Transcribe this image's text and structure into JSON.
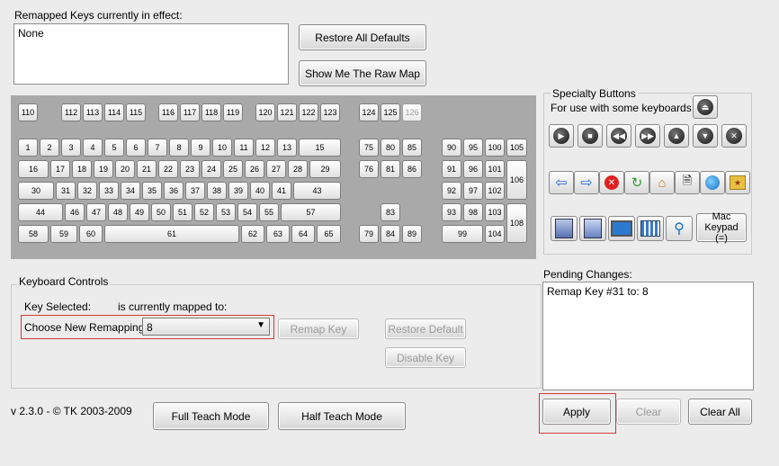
{
  "remapped": {
    "label": "Remapped Keys currently in effect:",
    "value": "None"
  },
  "buttons": {
    "restore_all": "Restore All Defaults",
    "raw_map": "Show Me The Raw Map"
  },
  "keyboard": {
    "fkeys": [
      "110",
      "112",
      "113",
      "114",
      "115",
      "116",
      "117",
      "118",
      "119",
      "120",
      "121",
      "122",
      "123",
      "124",
      "125",
      "126"
    ],
    "row1": [
      "1",
      "2",
      "3",
      "4",
      "5",
      "6",
      "7",
      "8",
      "9",
      "10",
      "11",
      "12",
      "13",
      "15"
    ],
    "row2": [
      "16",
      "17",
      "18",
      "19",
      "20",
      "21",
      "22",
      "23",
      "24",
      "25",
      "26",
      "27",
      "28",
      "29"
    ],
    "row3": [
      "30",
      "31",
      "32",
      "33",
      "34",
      "35",
      "36",
      "37",
      "38",
      "39",
      "40",
      "41",
      "43"
    ],
    "row4": [
      "44",
      "46",
      "47",
      "48",
      "49",
      "50",
      "51",
      "52",
      "53",
      "54",
      "55",
      "57"
    ],
    "row5": [
      "58",
      "59",
      "60",
      "61",
      "62",
      "63",
      "64",
      "65"
    ],
    "nav": [
      "75",
      "80",
      "85",
      "76",
      "81",
      "86",
      "83",
      "79",
      "84",
      "89"
    ],
    "numpad": [
      "90",
      "95",
      "100",
      "105",
      "91",
      "96",
      "101",
      "106",
      "92",
      "97",
      "102",
      "93",
      "98",
      "103",
      "108",
      "99",
      "104"
    ]
  },
  "specialty": {
    "title": "Specialty Buttons",
    "subtitle": "For use with some keyboards",
    "mac_label": "Mac Keypad (=)",
    "icons": [
      "eject-icon",
      "play-icon",
      "stop-icon",
      "rewind-icon",
      "fast-forward-icon",
      "volume-up-icon",
      "volume-down-icon",
      "mute-icon",
      "back-arrow-icon",
      "forward-arrow-icon",
      "stop-page-icon",
      "refresh-icon",
      "home-icon",
      "search-page-icon",
      "web-globe-icon",
      "favorites-icon",
      "my-computer-icon",
      "my-documents-icon",
      "computer-icon",
      "calculator-icon",
      "find-icon"
    ]
  },
  "controls": {
    "title": "Keyboard Controls",
    "key_selected": "Key Selected:",
    "mapped_to": "is currently mapped to:",
    "choose": "Choose New Remapping",
    "selection": "8",
    "remap": "Remap Key",
    "restore_default": "Restore Default",
    "disable": "Disable Key"
  },
  "pending": {
    "label": "Pending Changes:",
    "value": "Remap Key #31 to: 8"
  },
  "footer": {
    "version": "v 2.3.0 - © TK 2003-2009",
    "full_teach": "Full Teach Mode",
    "half_teach": "Half Teach Mode",
    "apply": "Apply",
    "clear": "Clear",
    "clear_all": "Clear All"
  }
}
